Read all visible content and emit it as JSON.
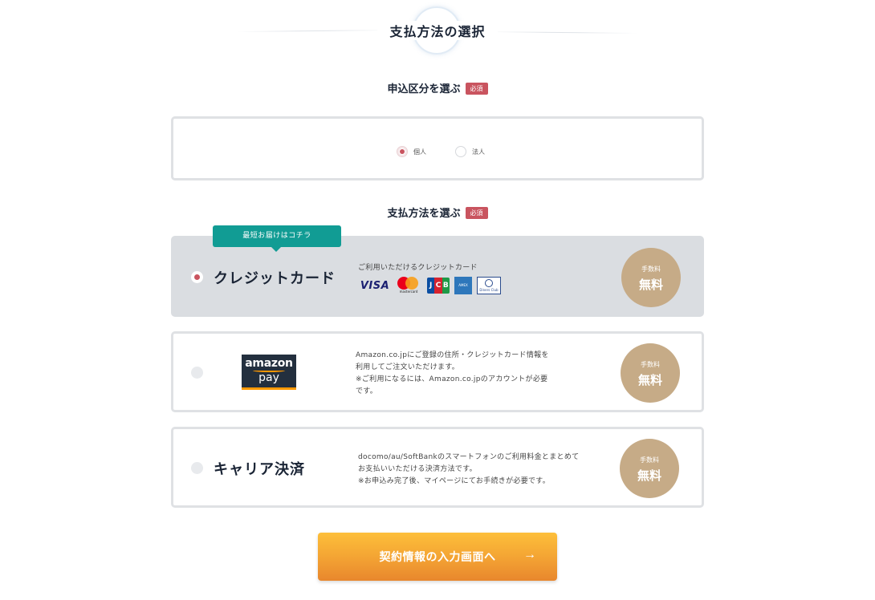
{
  "page": {
    "title": "支払方法の選択"
  },
  "apply_section": {
    "label": "申込区分を選ぶ",
    "required": "必須",
    "options": [
      {
        "label": "個人",
        "selected": true
      },
      {
        "label": "法人",
        "selected": false
      }
    ]
  },
  "payment_section": {
    "label": "支払方法を選ぶ",
    "required": "必須",
    "ribbon": "最短お届けはコチラ",
    "methods": [
      {
        "name": "クレジットカード",
        "selected": true,
        "desc_title": "ご利用いただけるクレジットカード",
        "logos": [
          "VISA",
          "mastercard",
          "JCB",
          "AMERICAN EXPRESS",
          "Diners Club INTERNATIONAL"
        ],
        "fee_label": "手数料",
        "fee_value": "無料"
      },
      {
        "name": "amazon pay",
        "logo_line1": "amazon",
        "logo_line2": "pay",
        "selected": false,
        "desc": [
          "Amazon.co.jpにご登録の住所・クレジットカード情報を",
          "利用してご注文いただけます。",
          "※ご利用になるには、Amazon.co.jpのアカウントが必要",
          "です。"
        ],
        "fee_label": "手数料",
        "fee_value": "無料"
      },
      {
        "name": "キャリア決済",
        "selected": false,
        "desc": [
          "docomo/au/SoftBankのスマートフォンのご利用料金とまとめて",
          "お支払いいただける決済方法です。",
          "※お申込み完了後、マイページにてお手続きが必要です。"
        ],
        "fee_label": "手数料",
        "fee_value": "無料"
      }
    ]
  },
  "submit": {
    "label": "契約情報の入力画面へ",
    "arrow": "→"
  },
  "colors": {
    "accent_red": "#c9545f",
    "teal": "#119c94",
    "fee_gold": "#c6ab87",
    "button_orange": "#f3a233"
  }
}
